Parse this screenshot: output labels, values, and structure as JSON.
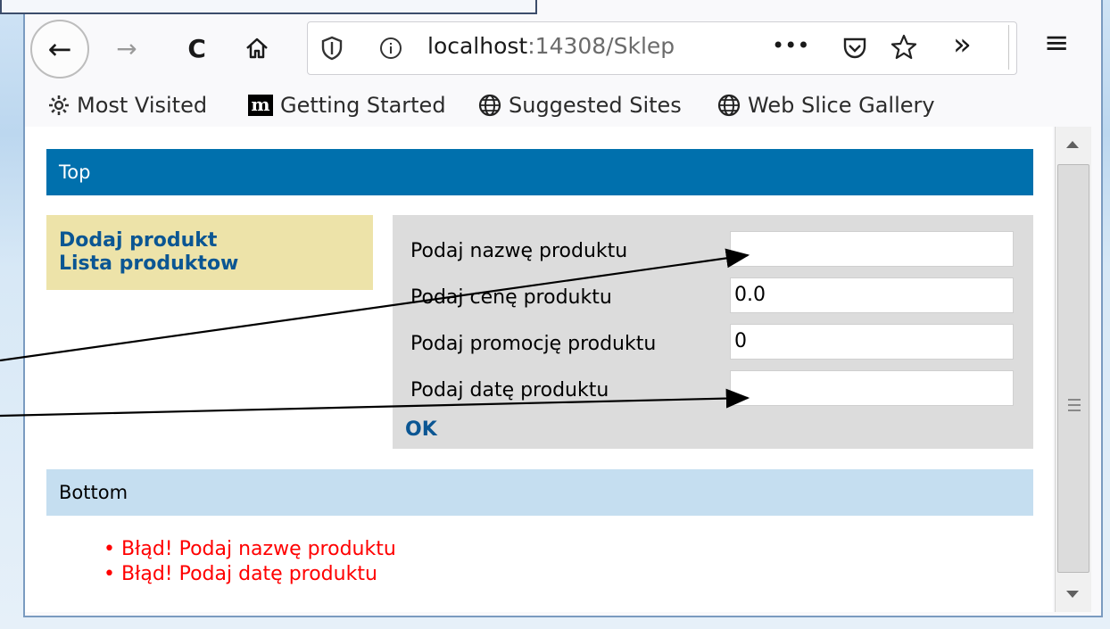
{
  "browser": {
    "url_host": "localhost",
    "url_rest": ":14308/Sklep",
    "page_actions": "•••",
    "overflow": "»",
    "menu": "≡"
  },
  "bookmarks": [
    {
      "label": "Most Visited",
      "icon": "gear-icon"
    },
    {
      "label": "Getting Started",
      "icon": "m-logo-icon"
    },
    {
      "label": "Suggested Sites",
      "icon": "globe-icon"
    },
    {
      "label": "Web Slice Gallery",
      "icon": "globe-icon"
    }
  ],
  "page": {
    "top_label": "Top",
    "menu": [
      "Dodaj produkt",
      "Lista produktow"
    ],
    "form": {
      "name_label": "Podaj nazwę produktu",
      "name_value": "",
      "price_label": "Podaj cenę produktu",
      "price_value": "0.0",
      "promo_label": "Podaj promocję produktu",
      "promo_value": "0",
      "date_label": "Podaj datę produktu",
      "date_value": "",
      "ok_label": "OK"
    },
    "bottom_label": "Bottom",
    "errors": [
      "Błąd! Podaj nazwę produktu",
      "Błąd! Podaj datę produktu"
    ]
  },
  "colors": {
    "top_bar": "#0070ad",
    "side_menu": "#ede3a9",
    "form_panel": "#dcdcdc",
    "bottom_bar": "#c5def0",
    "error_text": "#ff0000",
    "link": "#0b5693"
  }
}
